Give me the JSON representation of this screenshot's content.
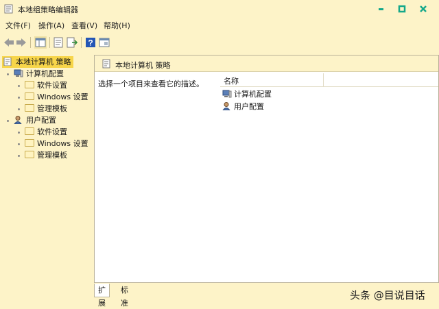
{
  "window": {
    "title": "本地组策略编辑器",
    "minimize_label": "▪",
    "maximize_label": "□",
    "close_label": "✕"
  },
  "menu": [
    {
      "label": "文件(F)"
    },
    {
      "label": "操作(A)"
    },
    {
      "label": "查看(V)"
    },
    {
      "label": "帮助(H)"
    }
  ],
  "tree": {
    "root": "本地计算机 策略",
    "computer": {
      "label": "计算机配置",
      "children": [
        "软件设置",
        "Windows 设置",
        "管理模板"
      ]
    },
    "user": {
      "label": "用户配置",
      "children": [
        "软件设置",
        "Windows 设置",
        "管理模板"
      ]
    }
  },
  "panel": {
    "title": "本地计算机 策略",
    "description": "选择一个项目来查看它的描述。",
    "column_name": "名称",
    "items": [
      "计算机配置",
      "用户配置"
    ]
  },
  "tabs": [
    "扩展",
    "标准"
  ],
  "watermark": "头条 @目说目话",
  "colors": {
    "background": "#fdf3c8",
    "selection": "#f7d54a",
    "window_buttons": "#14a88a"
  }
}
